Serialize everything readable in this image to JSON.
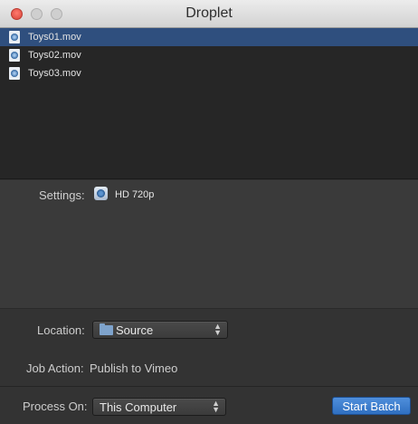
{
  "window": {
    "title": "Droplet"
  },
  "files": [
    {
      "name": "Toys01.mov",
      "selected": true
    },
    {
      "name": "Toys02.mov",
      "selected": false
    },
    {
      "name": "Toys03.mov",
      "selected": false
    }
  ],
  "settings": {
    "label": "Settings:",
    "value": "HD 720p",
    "icon": "compressor-setting-icon"
  },
  "location": {
    "label": "Location:",
    "value": "Source",
    "icon": "folder-icon"
  },
  "job_action": {
    "label": "Job Action:",
    "value": "Publish to Vimeo"
  },
  "process_on": {
    "label": "Process On:",
    "value": "This Computer"
  },
  "start_button": {
    "label": "Start Batch"
  },
  "colors": {
    "selection": "#2f4f7e",
    "accent": "#2f6fc0"
  }
}
